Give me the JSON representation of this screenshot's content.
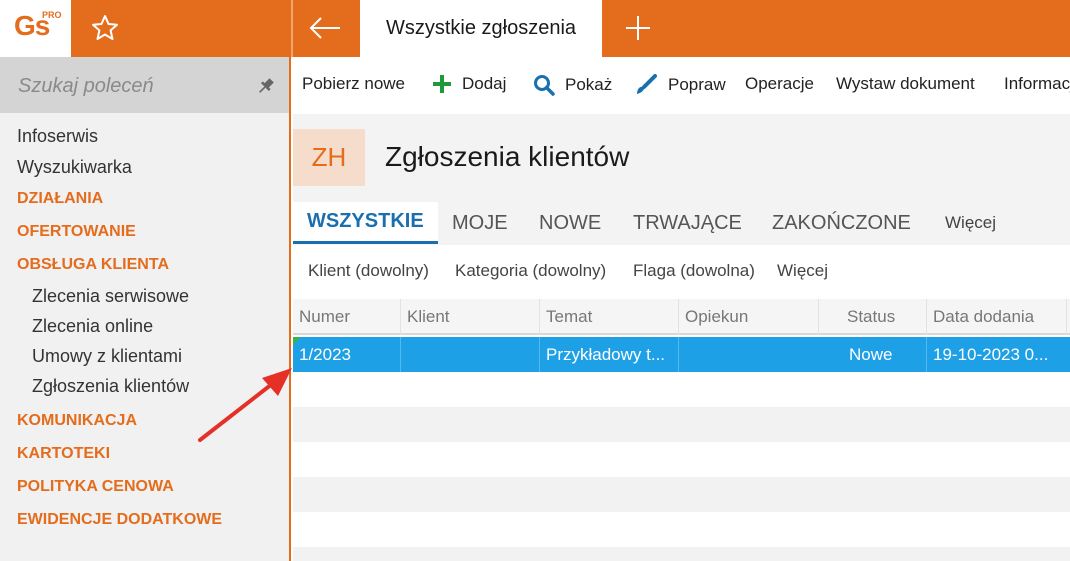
{
  "app": {
    "logo_text": "Gs",
    "logo_badge": "PRO"
  },
  "topbar": {
    "active_tab": "Wszystkie zgłoszenia"
  },
  "sidebar": {
    "search_placeholder": "Szukaj poleceń",
    "items": {
      "infoserwis": "Infoserwis",
      "wyszukiwarka": "Wyszukiwarka",
      "dzialania": "DZIAŁANIA",
      "ofertowanie": "OFERTOWANIE",
      "obsluga_klienta": "OBSŁUGA KLIENTA",
      "zlecenia_serwisowe": "Zlecenia serwisowe",
      "zlecenia_online": "Zlecenia online",
      "umowy_z_klientami": "Umowy z klientami",
      "zgloszenia_klientow": "Zgłoszenia klientów",
      "komunikacja": "KOMUNIKACJA",
      "kartoteki": "KARTOTEKI",
      "polityka_cenowa": "POLITYKA CENOWA",
      "ewidencje_dodatkowe": "EWIDENCJE DODATKOWE"
    }
  },
  "toolbar": {
    "pobierz_nowe": "Pobierz nowe",
    "dodaj": "Dodaj",
    "pokaz": "Pokaż",
    "popraw": "Popraw",
    "operacje": "Operacje",
    "wystaw_dokument": "Wystaw dokument",
    "informacje": "Informacje"
  },
  "page": {
    "badge": "ZH",
    "title": "Zgłoszenia klientów"
  },
  "tabs": {
    "wszystkie": "WSZYSTKIE",
    "moje": "MOJE",
    "nowe": "NOWE",
    "trwajace": "TRWAJĄCE",
    "zakonczone": "ZAKOŃCZONE",
    "wiecej": "Więcej"
  },
  "filters": {
    "klient": "Klient (dowolny)",
    "kategoria": "Kategoria (dowolny)",
    "flaga": "Flaga (dowolna)",
    "wiecej": "Więcej"
  },
  "grid": {
    "columns": {
      "numer": "Numer",
      "klient": "Klient",
      "temat": "Temat",
      "opiekun": "Opiekun",
      "status": "Status",
      "data_dodania": "Data dodania"
    },
    "rows": [
      {
        "numer": "1/2023",
        "klient": "",
        "temat": "Przykładowy t...",
        "opiekun": "",
        "status": "Nowe",
        "data_dodania": "19-10-2023 0..."
      }
    ]
  },
  "colors": {
    "accent": "#e46c1d",
    "selection": "#1ea0e6",
    "tab_active": "#1a6fae"
  }
}
